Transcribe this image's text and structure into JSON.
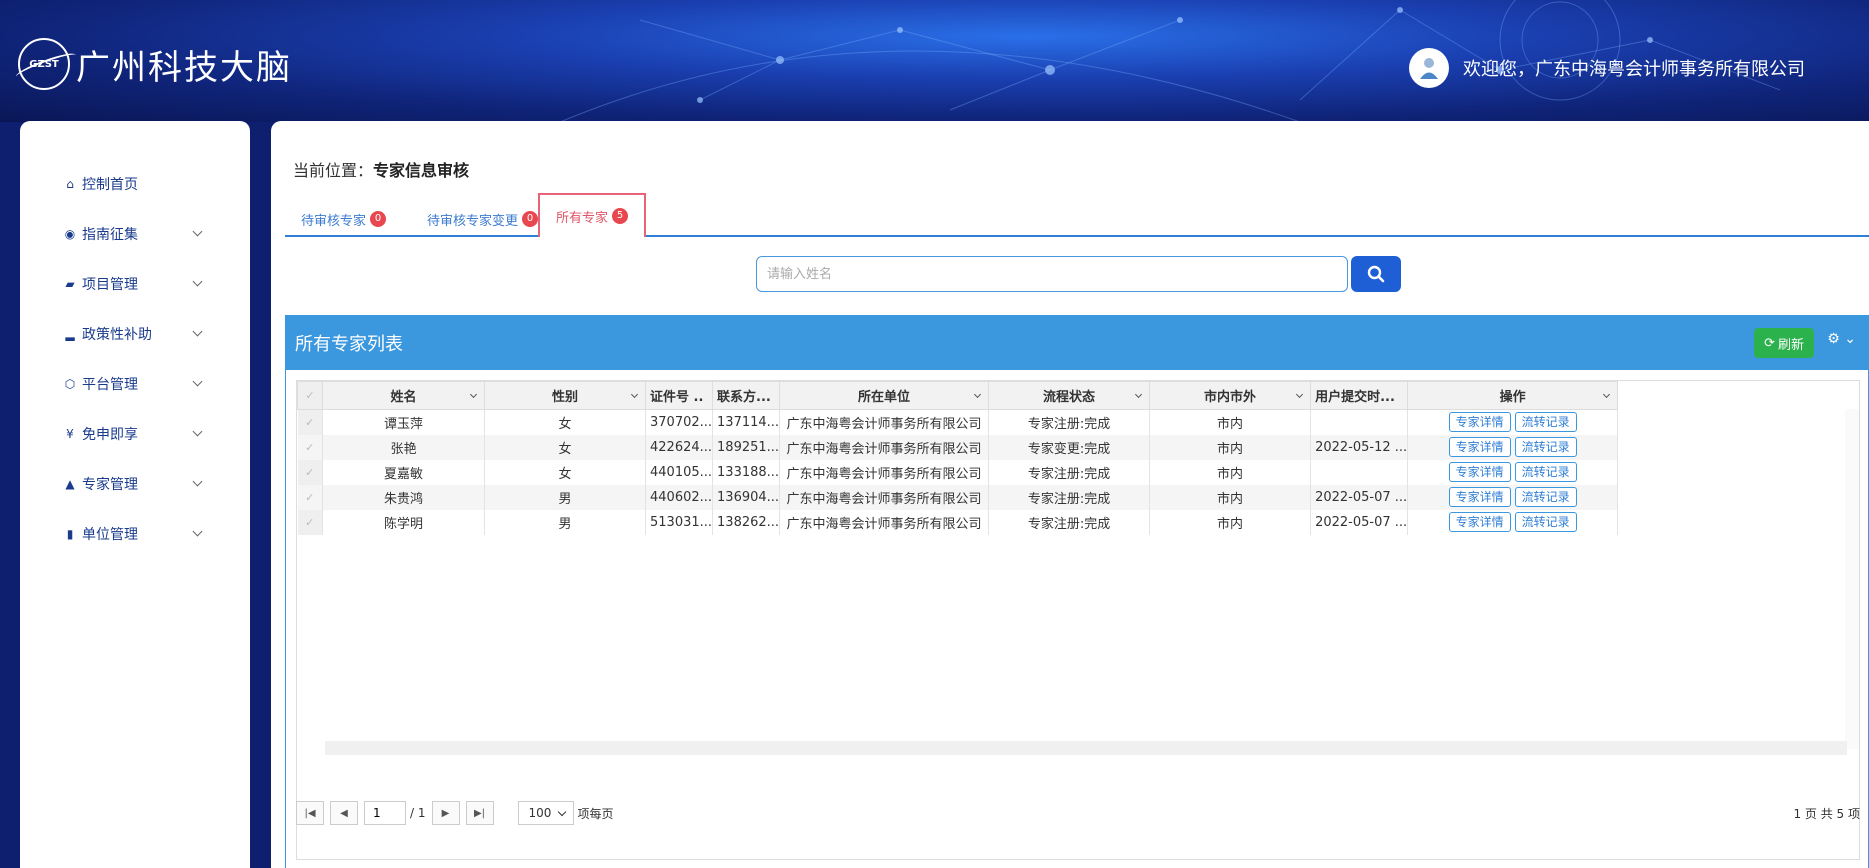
{
  "header": {
    "logo_mark": "GZST",
    "logo_text": "广州科技大脑",
    "welcome": "欢迎您，广东中海粤会计师事务所有限公司"
  },
  "sidebar": {
    "items": [
      {
        "label": "控制首页",
        "icon": "home-icon",
        "glyph": "⌂"
      },
      {
        "label": "指南征集",
        "icon": "globe-icon",
        "glyph": "◉"
      },
      {
        "label": "项目管理",
        "icon": "folder-icon",
        "glyph": "▰"
      },
      {
        "label": "政策性补助",
        "icon": "signal-icon",
        "glyph": "▂"
      },
      {
        "label": "平台管理",
        "icon": "cube-icon",
        "glyph": "⬡"
      },
      {
        "label": "免申即享",
        "icon": "yen-icon",
        "glyph": "¥"
      },
      {
        "label": "专家管理",
        "icon": "graduation-cap-icon",
        "glyph": "▲"
      },
      {
        "label": "单位管理",
        "icon": "building-icon",
        "glyph": "▮"
      }
    ]
  },
  "breadcrumb": {
    "prefix": "当前位置：",
    "current": "专家信息审核"
  },
  "tabs": [
    {
      "label": "待审核专家",
      "count": "0"
    },
    {
      "label": "待审核专家变更",
      "count": "0"
    },
    {
      "label": "所有专家",
      "count": "5"
    }
  ],
  "search": {
    "placeholder": "请输入姓名",
    "value": ""
  },
  "list": {
    "title": "所有专家列表",
    "refresh_label": "刷新",
    "columns": [
      "姓名",
      "性别",
      "证件号 ..",
      "联系方...",
      "所在单位",
      "流程状态",
      "市内市外",
      "用户提交时...",
      "操作"
    ],
    "rows": [
      {
        "name": "谭玉萍",
        "gender": "女",
        "id": "370702...",
        "phone": "137114...",
        "org": "广东中海粤会计师事务所有限公司",
        "status": "专家注册:完成",
        "region": "市内",
        "submitted": ""
      },
      {
        "name": "张艳",
        "gender": "女",
        "id": "422624...",
        "phone": "189251...",
        "org": "广东中海粤会计师事务所有限公司",
        "status": "专家变更:完成",
        "region": "市内",
        "submitted": "2022-05-12 ..."
      },
      {
        "name": "夏嘉敏",
        "gender": "女",
        "id": "440105...",
        "phone": "133188...",
        "org": "广东中海粤会计师事务所有限公司",
        "status": "专家注册:完成",
        "region": "市内",
        "submitted": ""
      },
      {
        "name": "朱贵鸿",
        "gender": "男",
        "id": "440602...",
        "phone": "136904...",
        "org": "广东中海粤会计师事务所有限公司",
        "status": "专家注册:完成",
        "region": "市内",
        "submitted": "2022-05-07 ..."
      },
      {
        "name": "陈学明",
        "gender": "男",
        "id": "513031...",
        "phone": "138262...",
        "org": "广东中海粤会计师事务所有限公司",
        "status": "专家注册:完成",
        "region": "市内",
        "submitted": "2022-05-07 ..."
      }
    ],
    "op_detail": "专家详情",
    "op_log": "流转记录"
  },
  "pager": {
    "page": "1",
    "total_pages": "/ 1",
    "page_size": "100",
    "per_page_label": "项每页",
    "summary": "1 页 共 5 项"
  },
  "colors": {
    "accent": "#3b97de",
    "active_tab": "#e8637a",
    "refresh": "#2bb24c",
    "search_btn": "#1f5fd6"
  }
}
